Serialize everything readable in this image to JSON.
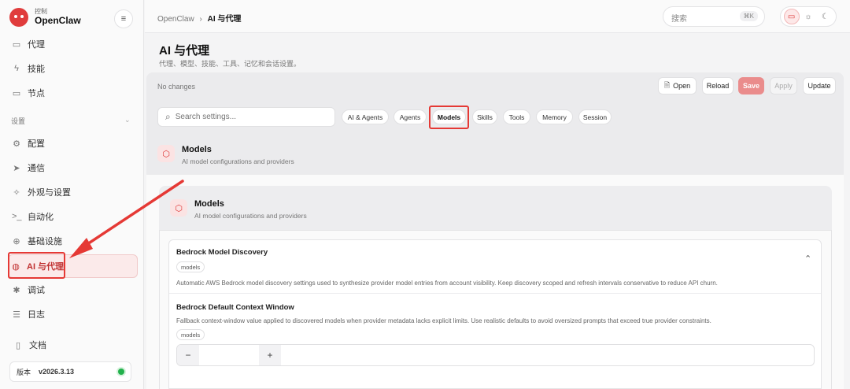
{
  "brand": {
    "sub": "控制",
    "name": "OpenClaw",
    "menu_icon": "hamburger-icon"
  },
  "sidebar": {
    "top_items": [
      {
        "label": "代理",
        "icon": "folder-icon"
      },
      {
        "label": "技能",
        "icon": "bolt-icon"
      },
      {
        "label": "节点",
        "icon": "monitor-icon"
      }
    ],
    "section_label": "设置",
    "settings_items": [
      {
        "label": "配置",
        "icon": "gear-icon"
      },
      {
        "label": "通信",
        "icon": "send-icon"
      },
      {
        "label": "外观与设置",
        "icon": "sparkle-icon"
      },
      {
        "label": "自动化",
        "icon": "terminal-icon"
      },
      {
        "label": "基础设施",
        "icon": "globe-icon"
      },
      {
        "label": "AI 与代理",
        "icon": "brain-icon",
        "active": true
      },
      {
        "label": "调试",
        "icon": "bug-icon"
      },
      {
        "label": "日志",
        "icon": "log-icon"
      }
    ],
    "docs_label": "文档",
    "version_label": "版本",
    "version_value": "v2026.3.13",
    "status_color": "#22b14c"
  },
  "topbar": {
    "breadcrumb_root": "OpenClaw",
    "breadcrumb_sep": "›",
    "breadcrumb_current": "AI 与代理",
    "search_placeholder": "搜索",
    "search_shortcut": "⌘K"
  },
  "page": {
    "title": "AI 与代理",
    "subtitle": "代理、模型、技能、工具、记忆和会话设置。"
  },
  "toolbar": {
    "status": "No changes",
    "open_label": "Open",
    "reload_label": "Reload",
    "save_label": "Save",
    "apply_label": "Apply",
    "update_label": "Update"
  },
  "filters": {
    "search_placeholder": "Search settings...",
    "pills": [
      "AI & Agents",
      "Agents",
      "Models",
      "Skills",
      "Tools",
      "Memory",
      "Session"
    ],
    "active": "Models"
  },
  "section": {
    "title": "Models",
    "description": "AI model configurations and providers"
  },
  "card": {
    "title": "Models",
    "description": "AI model configurations and providers"
  },
  "fields": {
    "discovery": {
      "title": "Bedrock Model Discovery",
      "tag": "models",
      "description": "Automatic AWS Bedrock model discovery settings used to synthesize provider model entries from account visibility. Keep discovery scoped and refresh intervals conservative to reduce API churn."
    },
    "context_window": {
      "title": "Bedrock Default Context Window",
      "description": "Fallback context-window value applied to discovered models when provider metadata lacks explicit limits. Use realistic defaults to avoid oversized prompts that exceed true provider constraints.",
      "tag": "models",
      "value": "",
      "minus": "−",
      "plus": "+"
    }
  },
  "colors": {
    "accent": "#e53935",
    "active_bg": "#fbeaea"
  }
}
